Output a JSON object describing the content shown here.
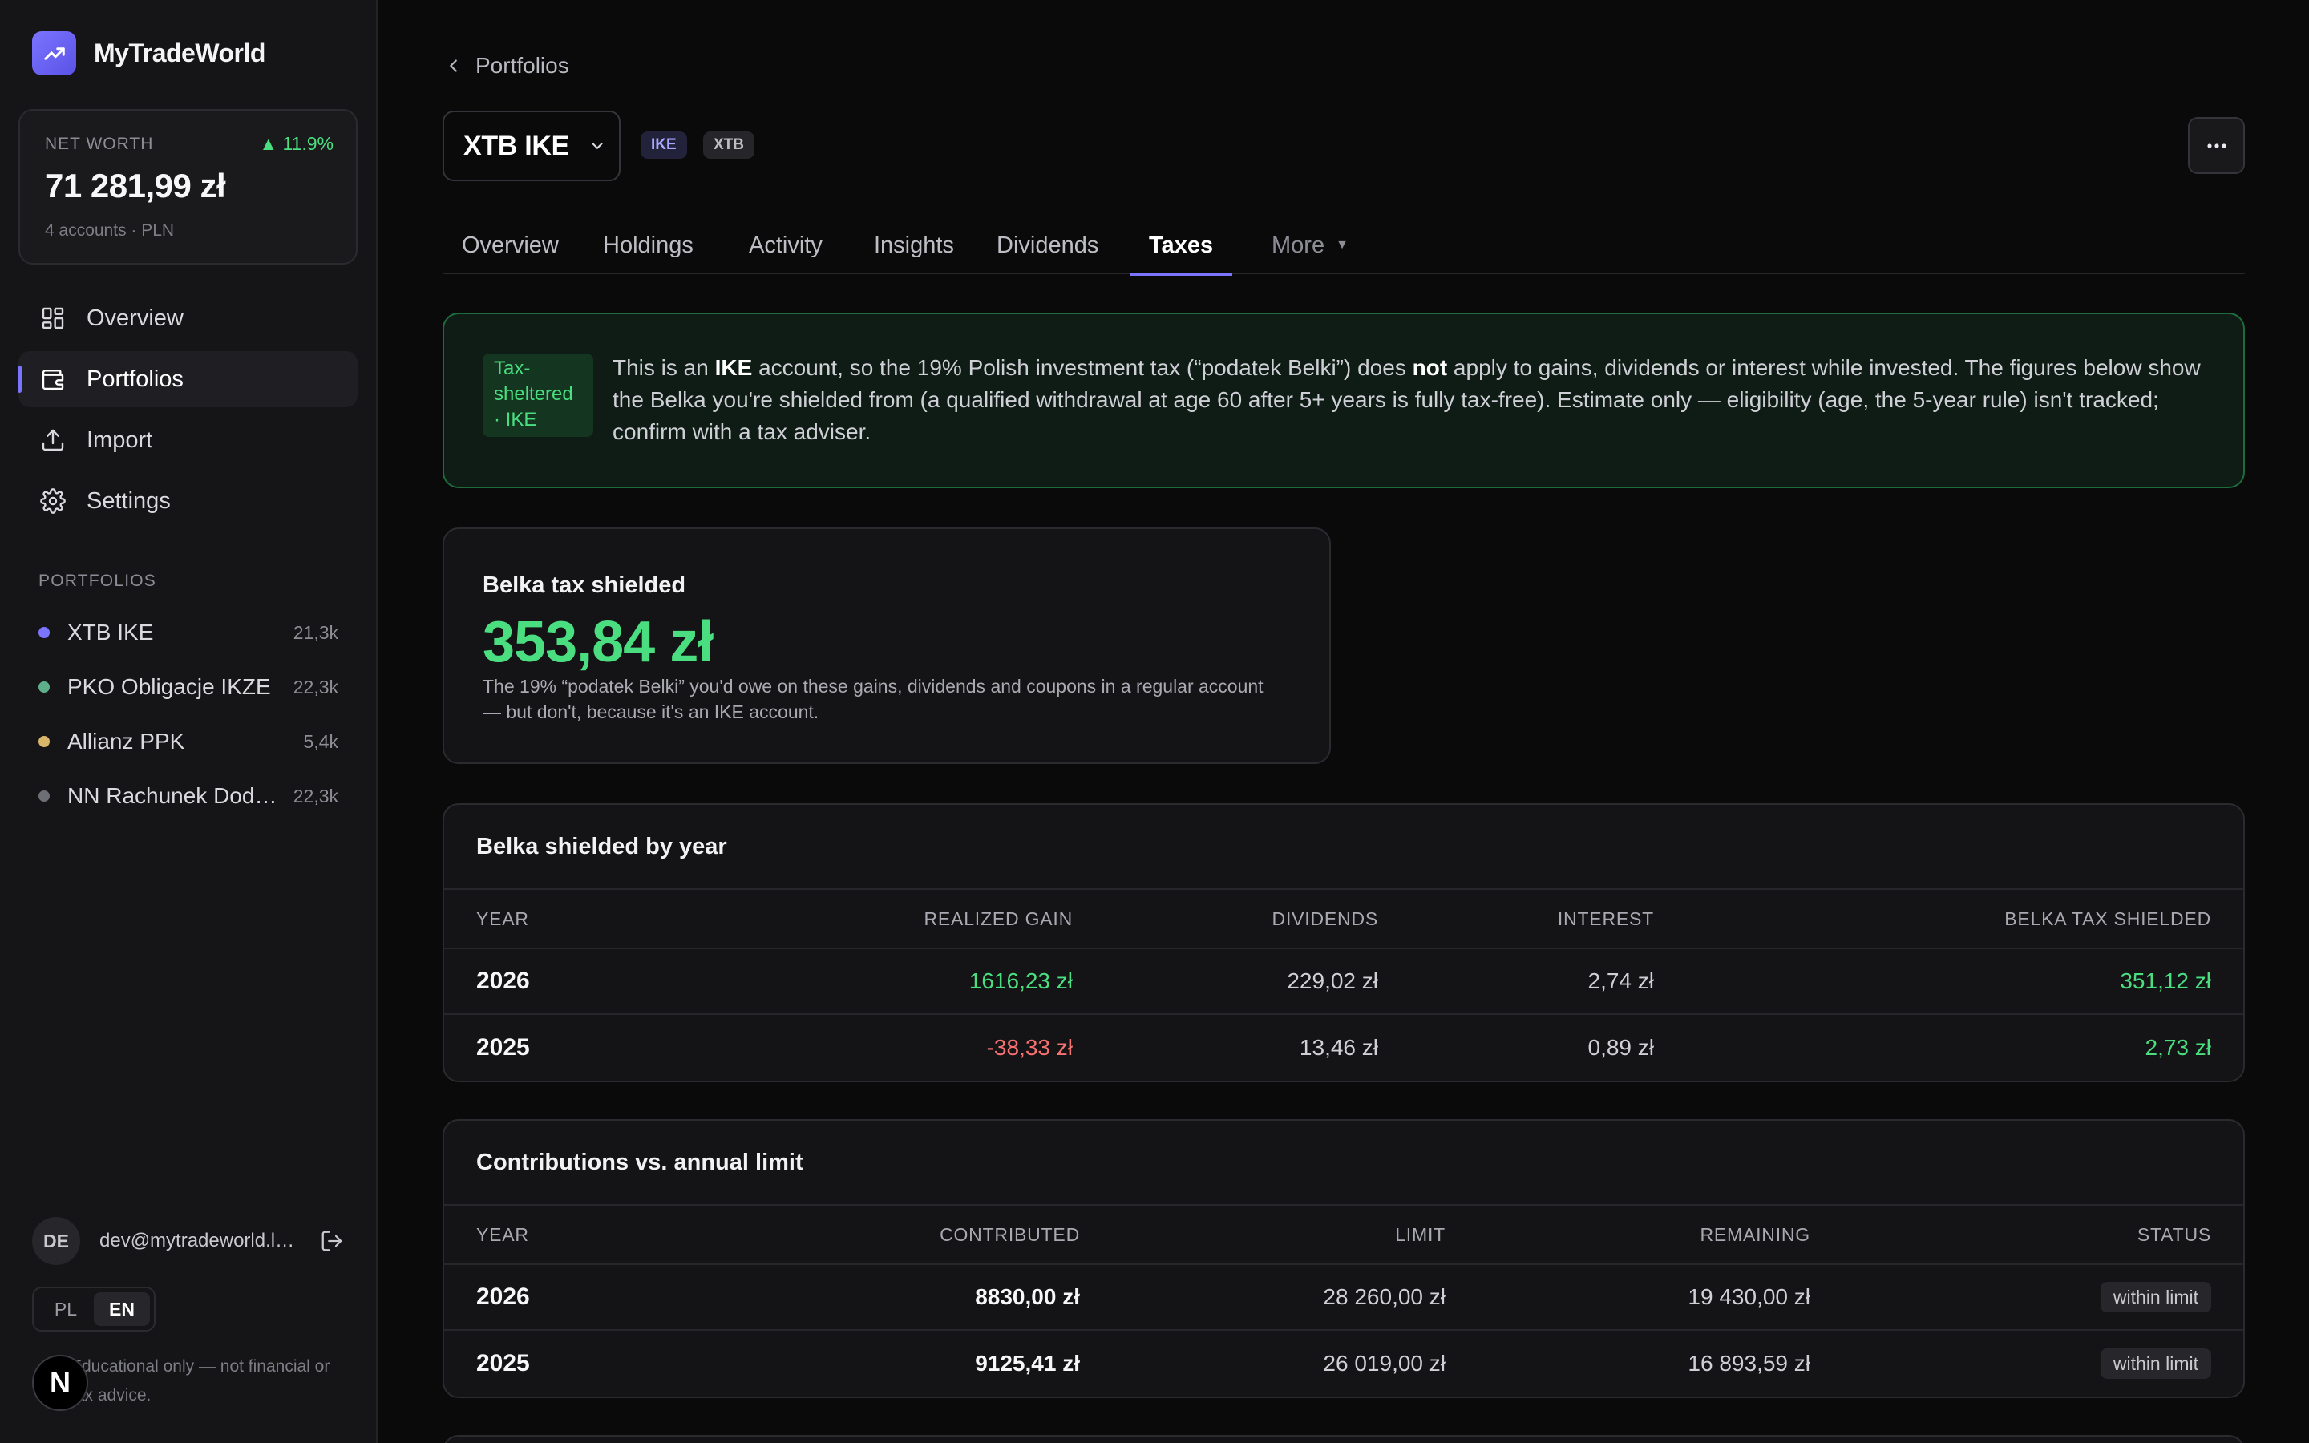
{
  "app": {
    "name": "MyTradeWorld"
  },
  "net_worth": {
    "label": "NET WORTH",
    "change": "▲ 11.9%",
    "value": "71 281,99 zł",
    "sub": "4 accounts · PLN"
  },
  "nav": [
    {
      "label": "Overview",
      "icon": "grid-icon"
    },
    {
      "label": "Portfolios",
      "icon": "wallet-icon",
      "active": true
    },
    {
      "label": "Import",
      "icon": "upload-icon"
    },
    {
      "label": "Settings",
      "icon": "gear-icon"
    }
  ],
  "portfolios": {
    "heading": "PORTFOLIOS",
    "items": [
      {
        "name": "XTB IKE",
        "amount": "21,3k",
        "color": "#7b74ff"
      },
      {
        "name": "PKO Obligacje IKZE",
        "amount": "22,3k",
        "color": "#5fae8b"
      },
      {
        "name": "Allianz PPK",
        "amount": "5,4k",
        "color": "#d9b56a"
      },
      {
        "name": "NN Rachunek Dodatkowy",
        "amount": "22,3k",
        "color": "#6e6e76"
      }
    ]
  },
  "user": {
    "initials": "DE",
    "email": "dev@mytradeworld.local"
  },
  "lang": {
    "pl": "PL",
    "en": "EN",
    "active": "EN"
  },
  "disclaimer": "Educational only — not financial or tax advice.",
  "breadcrumb": "Portfolios",
  "account": {
    "name": "XTB IKE",
    "chips": [
      "IKE",
      "XTB"
    ]
  },
  "tabs": [
    {
      "label": "Overview"
    },
    {
      "label": "Holdings"
    },
    {
      "label": "Activity"
    },
    {
      "label": "Insights"
    },
    {
      "label": "Dividends"
    },
    {
      "label": "Taxes",
      "active": true
    },
    {
      "label": "More"
    }
  ],
  "notice": {
    "chip": "Tax-sheltered · IKE",
    "text_1": "This is an ",
    "text_bold_1": "IKE",
    "text_2": " account, so the 19% Polish investment tax (“podatek Belki”) does ",
    "text_bold_2": "not",
    "text_3": " apply to gains, dividends or interest while invested. The figures below show the Belka you're shielded from (a qualified withdrawal at age 60 after 5+ years is fully tax-free). Estimate only — eligibility (age, the 5-year rule) isn't tracked; confirm with a tax adviser."
  },
  "shield": {
    "title": "Belka tax shielded",
    "value": "353,84 zł",
    "note": "The 19% “podatek Belki” you'd owe on these gains, dividends and coupons in a regular account — but don't, because it's an IKE account."
  },
  "by_year": {
    "title": "Belka shielded by year",
    "headers": {
      "year": "YEAR",
      "realized": "REALIZED GAIN",
      "dividends": "DIVIDENDS",
      "interest": "INTEREST",
      "shielded": "BELKA TAX SHIELDED"
    },
    "rows": [
      {
        "year": "2026",
        "realized": "1616,23 zł",
        "dividends": "229,02 zł",
        "interest": "2,74 zł",
        "shielded": "351,12 zł"
      },
      {
        "year": "2025",
        "realized": "-38,33 zł",
        "dividends": "13,46 zł",
        "interest": "0,89 zł",
        "shielded": "2,73 zł"
      }
    ]
  },
  "contributions": {
    "title": "Contributions vs. annual limit",
    "headers": {
      "year": "YEAR",
      "contributed": "CONTRIBUTED",
      "limit": "LIMIT",
      "remaining": "REMAINING",
      "status": "STATUS"
    },
    "rows": [
      {
        "year": "2026",
        "contributed": "8830,00 zł",
        "limit": "28 260,00 zł",
        "remaining": "19 430,00 zł",
        "status": "within limit"
      },
      {
        "year": "2025",
        "contributed": "9125,41 zł",
        "limit": "26 019,00 zł",
        "remaining": "16 893,59 zł",
        "status": "within limit"
      }
    ]
  },
  "colors": {
    "accent": "#7b74ff",
    "positive": "#4ade80",
    "negative": "#f87171"
  }
}
